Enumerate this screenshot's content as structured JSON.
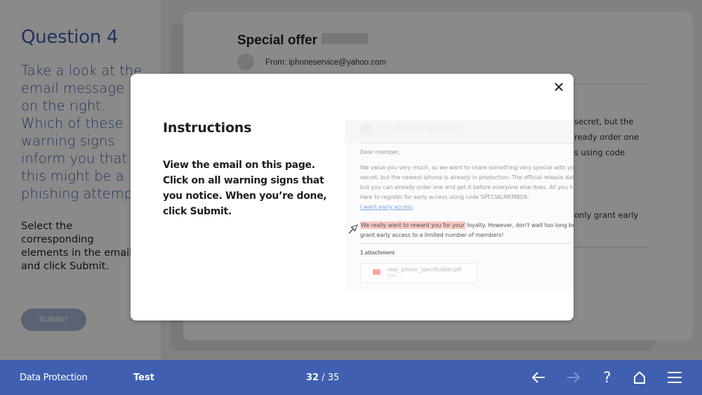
{
  "question": {
    "title": "Question 4",
    "prompt_lines": [
      "Take a look at the",
      "email message",
      "on the right.",
      "Which of these",
      "warning signs",
      "inform you that",
      "this might be a",
      "phishing attempt?"
    ],
    "sub_lines": [
      "Select the",
      "corresponding",
      "elements in the email",
      "and click Submit."
    ],
    "submit_label": "SUBMIT"
  },
  "email": {
    "subject": "Special offer",
    "from": "From: iphoneservice@yahoo.com",
    "bg_fragments": [
      "secret, but the",
      "ready order one",
      "s using code",
      "only grant early"
    ]
  },
  "modal": {
    "close_symbol": "✕",
    "title": "Instructions",
    "body": "View the email on this page. Click on all warning signs that you notice. When you’re done, click Submit.",
    "preview": {
      "from": "From: iphoneservice@yahoo.com",
      "greeting": "Dear member,",
      "para1_lines": [
        "We value you very much, so we want to share something very special with you. This is a",
        "secret, but the newest iphone is already in production. The official release date is",
        "but you can already order one and get it before everyone else does. All you have to do is click",
        "here to register for early access using code SPECIALMEMBER:"
      ],
      "link": "I want early access",
      "highlight": "We really want to reward you for your",
      "para2_rest": " loyalty. However, don't wait too long because",
      "para2_line2": "grant early access to a limited number of members!",
      "attachment_title": "1 attachment",
      "attachment_name": "new_iphone_specification.pdf",
      "attachment_size": "24 kb"
    }
  },
  "footer": {
    "course": "Data Protection",
    "section": "Test",
    "page_current": "32",
    "page_separator": " / ",
    "page_total": "35",
    "buttons": [
      "back-arrow",
      "forward-arrow",
      "help",
      "home",
      "menu"
    ],
    "help_symbol": "?"
  },
  "colors": {
    "brand_blue": "#3f5fb0",
    "highlight": "#f8c9c2",
    "link": "#7aa8e0"
  }
}
